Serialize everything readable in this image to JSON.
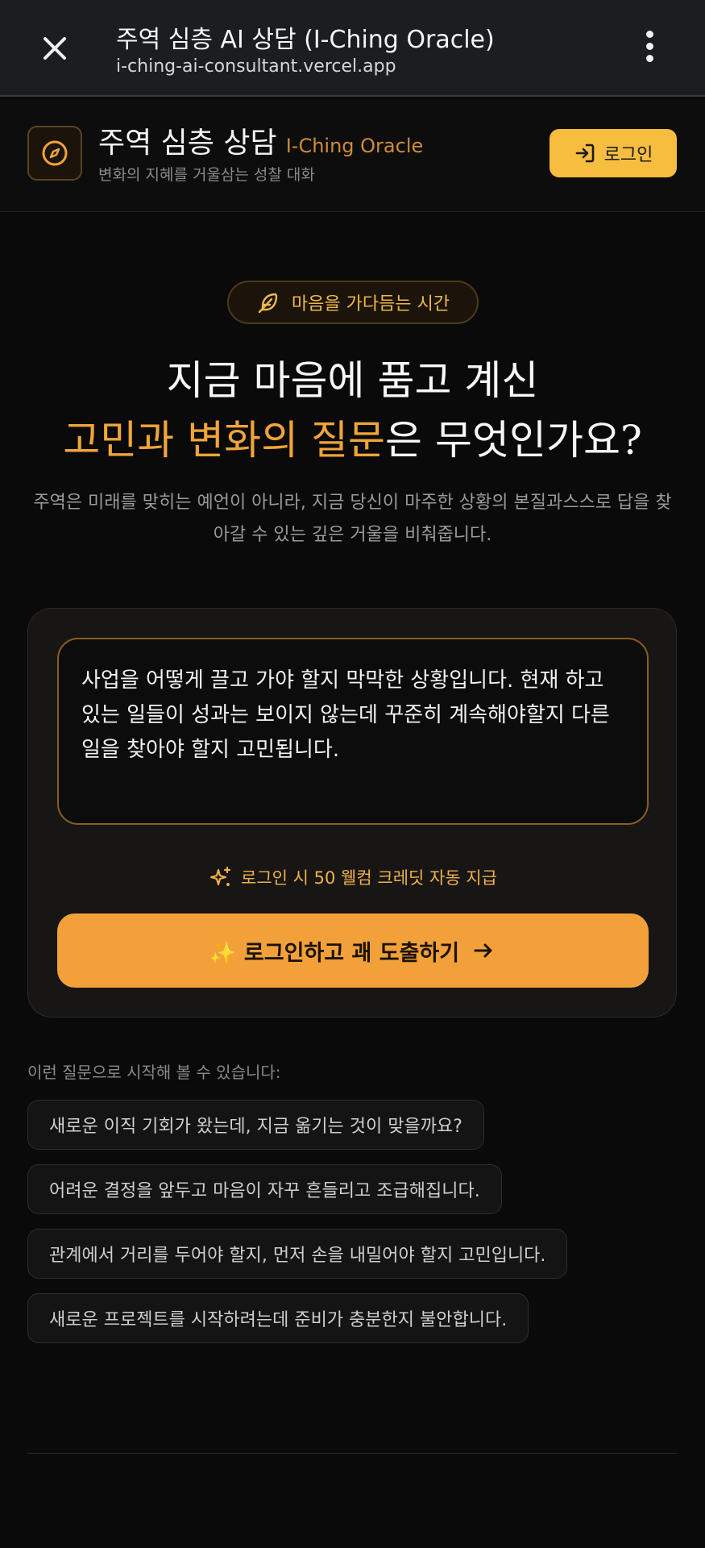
{
  "browser": {
    "title": "주역 심층 AI 상담 (I-Ching Oracle)",
    "url": "i-ching-ai-consultant.vercel.app"
  },
  "header": {
    "title_ko": "주역 심층 상담",
    "title_en": "I-Ching Oracle",
    "subtitle": "변화의 지혜를 거울삼는 성찰 대화",
    "login_label": "로그인"
  },
  "hero": {
    "pill_label": "마음을 가다듬는 시간",
    "line1": "지금 마음에 품고 계신",
    "line2_accent": "고민과 변화의 질문",
    "line2_rest": "은 무엇인가요?",
    "description": "주역은 미래를 맞히는 예언이 아니라, 지금 당신이 마주한 상황의 본질과스스로 답을 찾아갈 수 있는 깊은 거울을 비춰줍니다."
  },
  "form": {
    "question_value": "사업을 어떻게 끌고 가야 할지 막막한 상황입니다. 현재 하고 있는 일들이 성과는 보이지 않는데 꾸준히 계속해야할지 다른일을 찾아야 할지 고민됩니다.",
    "credit_note": "로그인 시 50 웰컴 크레딧 자동 지급",
    "cta_label": "✨ 로그인하고 괘 도출하기"
  },
  "suggestions": {
    "label": "이런 질문으로 시작해 볼 수 있습니다:",
    "items": [
      "새로운 이직 기회가 왔는데, 지금 옮기는 것이 맞을까요?",
      "어려운 결정을 앞두고 마음이 자꾸 흔들리고 조급해집니다.",
      "관계에서 거리를 두어야 할지, 먼저 손을 내밀어야 할지 고민입니다.",
      "새로운 프로젝트를 시작하려는데 준비가 충분한지 불안합니다."
    ]
  },
  "colors": {
    "accent": "#f2a03a",
    "login_bg": "#f6bd3e",
    "background": "#0a0a0a"
  },
  "icons": {
    "close": "close-icon",
    "menu": "more-vert-icon",
    "logo": "compass-icon",
    "login": "login-icon",
    "pill": "feather-icon",
    "credit": "sparkles-icon",
    "cta_arrow": "arrow-right-icon"
  }
}
